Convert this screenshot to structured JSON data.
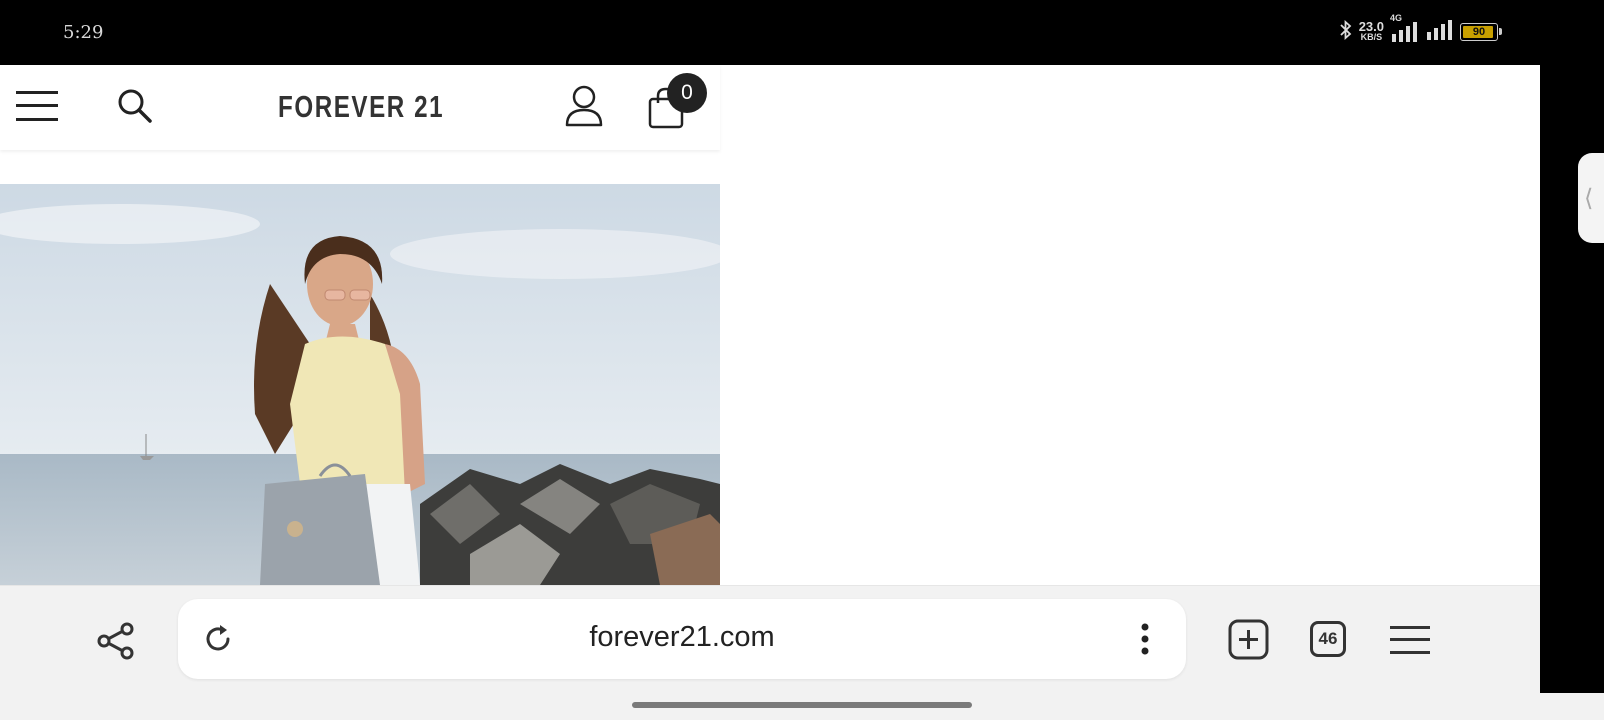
{
  "status_bar": {
    "time": "5:29",
    "net_speed_value": "23.0",
    "net_speed_unit": "KB/S",
    "network_type": "4G",
    "battery_level": "90",
    "icons": [
      "bluetooth-icon",
      "signal-icon",
      "signal-icon",
      "battery-icon"
    ]
  },
  "site": {
    "brand": "FOREVER 21",
    "cart_count": "0",
    "header_icons": [
      "menu-icon",
      "search-icon",
      "account-icon",
      "shopping-bag-icon"
    ]
  },
  "toolbar": {
    "url": "forever21.com",
    "tab_count": "46",
    "icons": [
      "share-icon",
      "reload-icon",
      "more-vertical-icon",
      "new-tab-icon",
      "tab-switcher-icon",
      "menu-icon"
    ]
  },
  "colors": {
    "status_bg": "#000000",
    "toolbar_bg": "#f2f2f2",
    "battery_fill": "#c8a000",
    "badge_bg": "#222222"
  }
}
